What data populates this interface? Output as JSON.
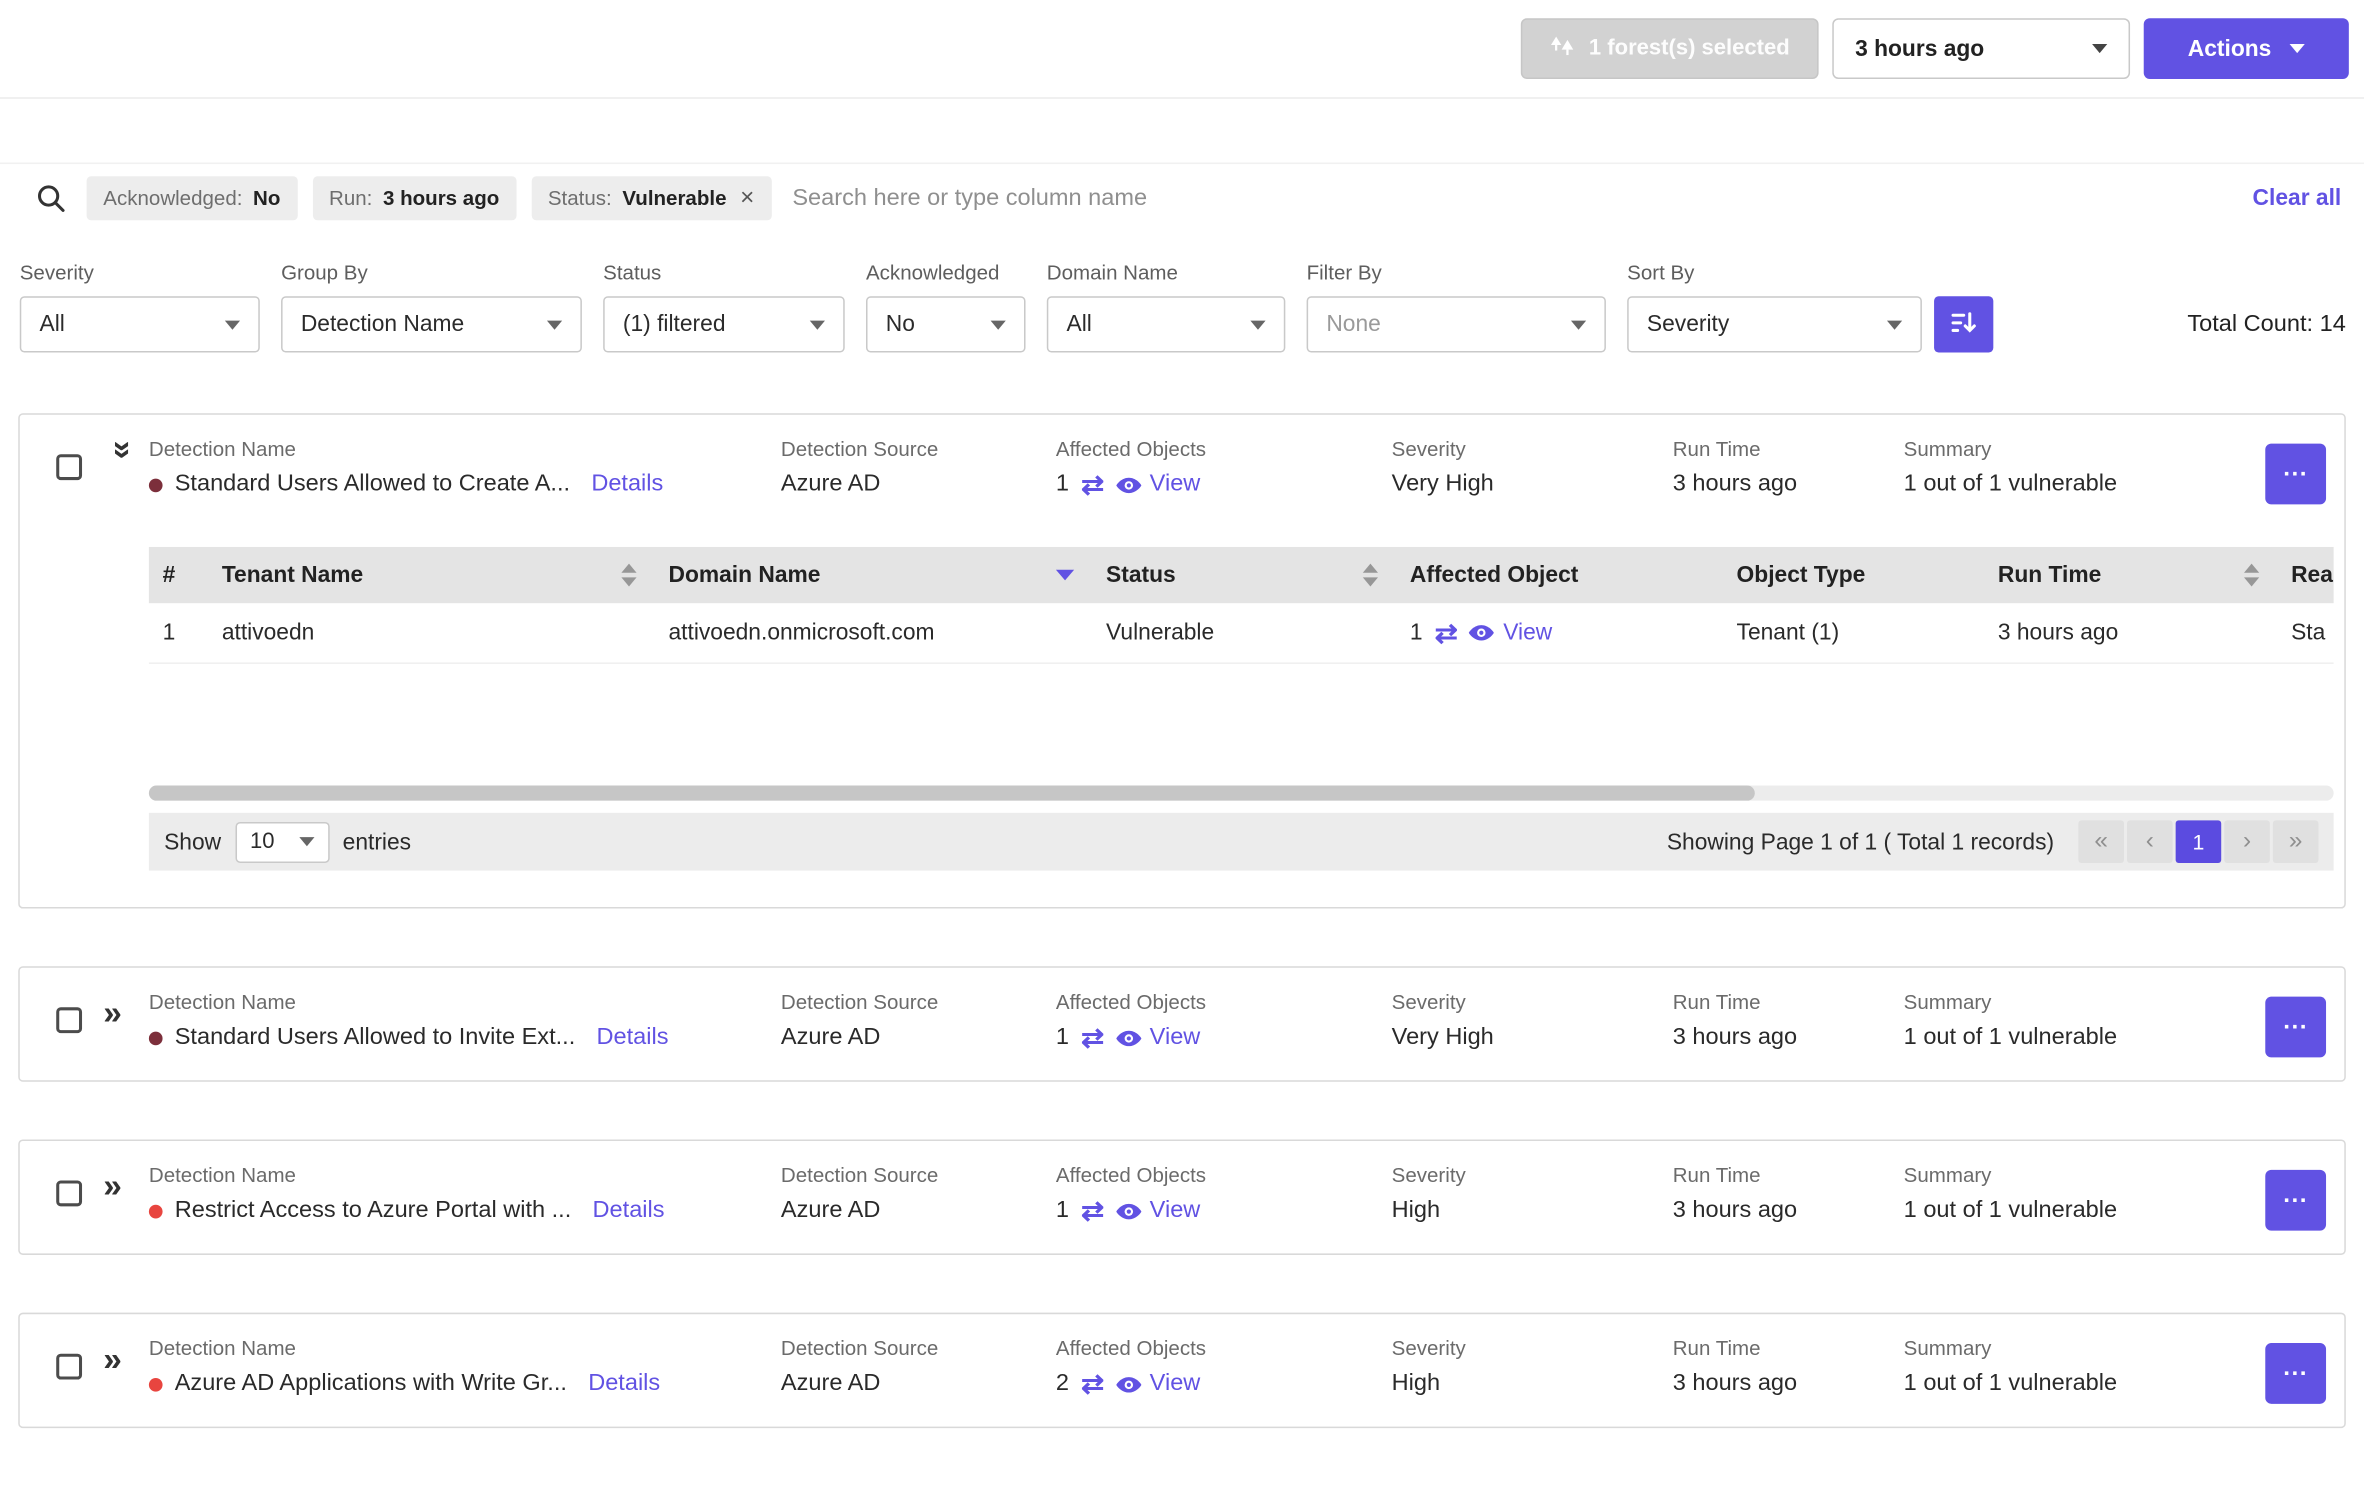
{
  "accent_color": "#6152e3",
  "header": {
    "forest_selected": "1 forest(s) selected",
    "time_range": "3 hours ago",
    "actions": "Actions"
  },
  "search": {
    "chips": [
      {
        "label": "Acknowledged:",
        "value": "No"
      },
      {
        "label": "Run:",
        "value": "3 hours ago"
      },
      {
        "label": "Status:",
        "value": "Vulnerable"
      }
    ],
    "placeholder": "Search here or type column name",
    "clear_all": "Clear all"
  },
  "filters": {
    "severity": {
      "label": "Severity",
      "value": "All"
    },
    "group_by": {
      "label": "Group By",
      "value": "Detection Name"
    },
    "status": {
      "label": "Status",
      "value": "(1) filtered"
    },
    "acknowledged": {
      "label": "Acknowledged",
      "value": "No"
    },
    "domain_name": {
      "label": "Domain Name",
      "value": "All"
    },
    "filter_by": {
      "label": "Filter By",
      "value": "None"
    },
    "sort_by": {
      "label": "Sort By",
      "value": "Severity"
    },
    "total_count": "Total Count: 14"
  },
  "labels": {
    "detection_name": "Detection Name",
    "detection_source": "Detection Source",
    "affected_objects": "Affected Objects",
    "severity": "Severity",
    "run_time": "Run Time",
    "summary": "Summary",
    "details": "Details",
    "view": "View"
  },
  "severity_colors": {
    "very_high": "#7c2f3b",
    "high": "#e8453f"
  },
  "detections": [
    {
      "name": "Standard Users Allowed to Create A...",
      "source": "Azure AD",
      "affected": "1",
      "severity": "Very High",
      "severity_color": "#7c2f3b",
      "run_time": "3 hours ago",
      "summary": "1 out of 1 vulnerable"
    },
    {
      "name": "Standard Users Allowed to Invite Ext...",
      "source": "Azure AD",
      "affected": "1",
      "severity": "Very High",
      "severity_color": "#7c2f3b",
      "run_time": "3 hours ago",
      "summary": "1 out of 1 vulnerable"
    },
    {
      "name": "Restrict Access to Azure Portal with ...",
      "source": "Azure AD",
      "affected": "1",
      "severity": "High",
      "severity_color": "#e8453f",
      "run_time": "3 hours ago",
      "summary": "1 out of 1 vulnerable"
    },
    {
      "name": "Azure AD Applications with Write Gr...",
      "source": "Azure AD",
      "affected": "2",
      "severity": "High",
      "severity_color": "#e8453f",
      "run_time": "3 hours ago",
      "summary": "1 out of 1 vulnerable"
    }
  ],
  "expanded_table": {
    "headers": {
      "num": "#",
      "tenant": "Tenant Name",
      "domain": "Domain Name",
      "status": "Status",
      "affected": "Affected Object",
      "object_type": "Object Type",
      "run_time": "Run Time",
      "clipped": "Rea"
    },
    "rows": [
      {
        "num": "1",
        "tenant": "attivoedn",
        "domain": "attivoedn.onmicrosoft.com",
        "status": "Vulnerable",
        "affected": "1",
        "object_type": "Tenant (1)",
        "run_time": "3 hours ago",
        "clipped": "Sta"
      }
    ],
    "footer": {
      "show": "Show",
      "page_size": "10",
      "entries": "entries",
      "paging": "Showing Page 1 of 1 ( Total 1 records)",
      "page": "1"
    }
  },
  "icons": {
    "swap": "⇄",
    "close": "×",
    "ellipsis": "...",
    "chevron": "»",
    "page_first": "«",
    "page_prev": "‹",
    "page_next": "›",
    "page_last": "»"
  }
}
